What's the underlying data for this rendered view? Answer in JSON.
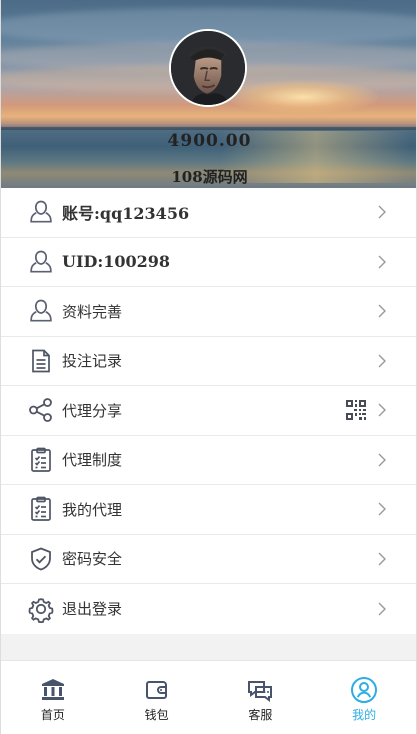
{
  "profile": {
    "balance": "4900.00",
    "site_name": "108源码网"
  },
  "menu": {
    "items": [
      {
        "label": "账号:qq123456"
      },
      {
        "label": "UID:100298"
      },
      {
        "label": "资料完善"
      },
      {
        "label": "投注记录"
      },
      {
        "label": "代理分享"
      },
      {
        "label": "代理制度"
      },
      {
        "label": "我的代理"
      },
      {
        "label": "密码安全"
      },
      {
        "label": "退出登录"
      }
    ]
  },
  "tabbar": {
    "items": [
      {
        "label": "首页",
        "icon": "bank-icon"
      },
      {
        "label": "钱包",
        "icon": "wallet-icon"
      },
      {
        "label": "客服",
        "icon": "chat-icon"
      },
      {
        "label": "我的",
        "icon": "user-circle-icon"
      }
    ],
    "active_color": "#2daee3"
  },
  "colors": {
    "text": "#333333",
    "icon": "#4b5563",
    "accent": "#2daee3"
  }
}
